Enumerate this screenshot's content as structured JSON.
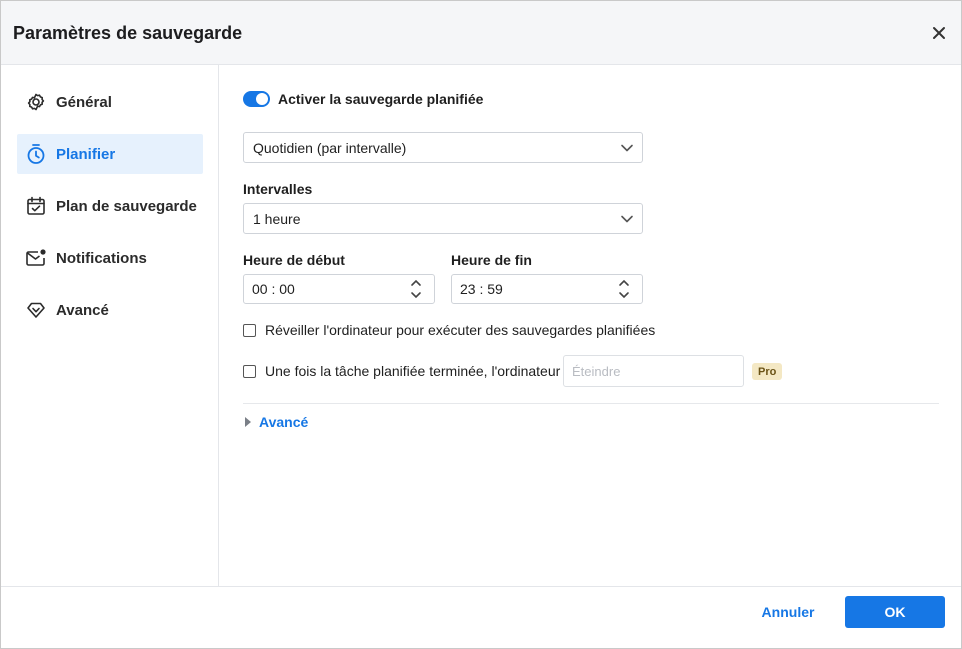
{
  "dialog": {
    "title": "Paramètres de sauvegarde",
    "close_icon": "close-icon"
  },
  "sidebar": {
    "items": [
      {
        "id": "general",
        "label": "Général",
        "icon": "gear-icon",
        "active": false
      },
      {
        "id": "planifier",
        "label": "Planifier",
        "icon": "timer-icon",
        "active": true
      },
      {
        "id": "plan",
        "label": "Plan de sauvegarde",
        "icon": "calendar-check-icon",
        "active": false
      },
      {
        "id": "notifications",
        "label": "Notifications",
        "icon": "mail-notification-icon",
        "active": false
      },
      {
        "id": "avance",
        "label": "Avancé",
        "icon": "diamond-icon",
        "active": false
      }
    ]
  },
  "schedule": {
    "enable_label": "Activer la sauvegarde planifiée",
    "enabled": true,
    "frequency_value": "Quotidien (par intervalle)",
    "interval_label": "Intervalles",
    "interval_value": "1 heure",
    "start_label": "Heure de début",
    "start_value": "00 : 00",
    "end_label": "Heure de fin",
    "end_value": "23 : 59",
    "wake_label": "Réveiller l'ordinateur pour exécuter des sauvegardes planifiées",
    "wake_checked": false,
    "after_label": "Une fois la tâche planifiée terminée, l'ordinateur",
    "after_checked": false,
    "after_placeholder": "Éteindre",
    "pro_badge": "Pro",
    "advanced_label": "Avancé"
  },
  "footer": {
    "cancel_label": "Annuler",
    "ok_label": "OK"
  },
  "colors": {
    "accent": "#1677e5",
    "active_bg": "#e6f1fd",
    "pro_badge_bg": "#f4e8c4"
  }
}
